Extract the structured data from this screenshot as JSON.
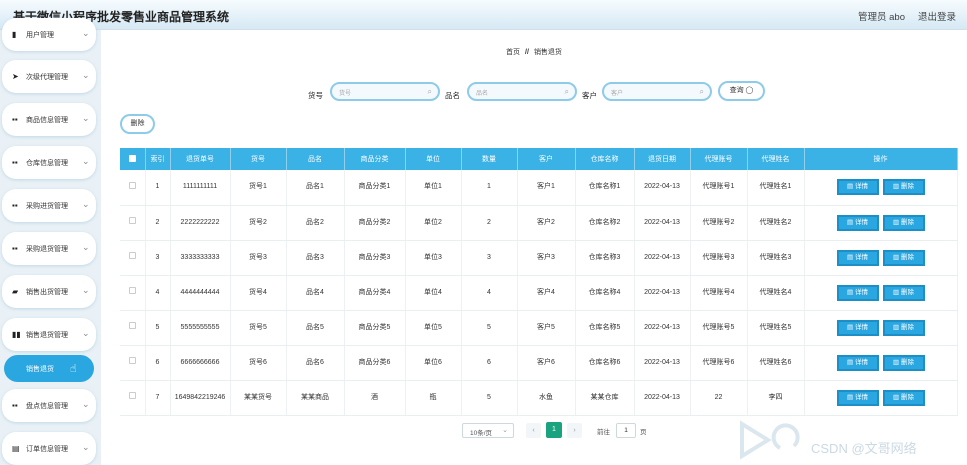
{
  "header": {
    "title": "基于微信小程序批发零售业商品管理系统",
    "admin": "管理员 abo",
    "logout": "退出登录"
  },
  "sidebar": {
    "items": [
      {
        "label": "用户管理",
        "icon": "user-icon",
        "glyph": "▮"
      },
      {
        "label": "次级代理管理",
        "icon": "send-icon",
        "glyph": "➤"
      },
      {
        "label": "商品信息管理",
        "icon": "grid-icon",
        "glyph": "▪▪"
      },
      {
        "label": "仓库信息管理",
        "icon": "grid-icon",
        "glyph": "▪▪"
      },
      {
        "label": "采购进货管理",
        "icon": "grid-icon",
        "glyph": "▪▪"
      },
      {
        "label": "采购退货管理",
        "icon": "grid-icon",
        "glyph": "▪▪"
      },
      {
        "label": "销售出货管理",
        "icon": "briefcase-icon",
        "glyph": "▰"
      },
      {
        "label": "销售退货管理",
        "icon": "chart-icon",
        "glyph": "▮▮"
      },
      {
        "label": "盘点信息管理",
        "icon": "grid-icon",
        "glyph": "▪▪"
      },
      {
        "label": "订单信息管理",
        "icon": "document-icon",
        "glyph": "▤"
      }
    ],
    "active_sub": "销售退货"
  },
  "breadcrumb": {
    "home": "首页",
    "sep": "//",
    "current": "销售退货"
  },
  "search": {
    "fields": [
      {
        "label": "货号",
        "placeholder": "货号"
      },
      {
        "label": "品名",
        "placeholder": "品名"
      },
      {
        "label": "客户",
        "placeholder": "客户"
      }
    ],
    "query_label": "查询 ◯"
  },
  "toolbar": {
    "delete_label": "删除"
  },
  "table": {
    "columns": [
      "",
      "索引",
      "退货单号",
      "货号",
      "品名",
      "商品分类",
      "单位",
      "数量",
      "客户",
      "仓库名称",
      "退货日期",
      "代理账号",
      "代理姓名",
      "操作"
    ],
    "rows": [
      [
        "1",
        "1111111111",
        "货号1",
        "品名1",
        "商品分类1",
        "单位1",
        "1",
        "客户1",
        "仓库名称1",
        "2022-04-13",
        "代理账号1",
        "代理姓名1"
      ],
      [
        "2",
        "2222222222",
        "货号2",
        "品名2",
        "商品分类2",
        "单位2",
        "2",
        "客户2",
        "仓库名称2",
        "2022-04-13",
        "代理账号2",
        "代理姓名2"
      ],
      [
        "3",
        "3333333333",
        "货号3",
        "品名3",
        "商品分类3",
        "单位3",
        "3",
        "客户3",
        "仓库名称3",
        "2022-04-13",
        "代理账号3",
        "代理姓名3"
      ],
      [
        "4",
        "4444444444",
        "货号4",
        "品名4",
        "商品分类4",
        "单位4",
        "4",
        "客户4",
        "仓库名称4",
        "2022-04-13",
        "代理账号4",
        "代理姓名4"
      ],
      [
        "5",
        "5555555555",
        "货号5",
        "品名5",
        "商品分类5",
        "单位5",
        "5",
        "客户5",
        "仓库名称5",
        "2022-04-13",
        "代理账号5",
        "代理姓名5"
      ],
      [
        "6",
        "6666666666",
        "货号6",
        "品名6",
        "商品分类6",
        "单位6",
        "6",
        "客户6",
        "仓库名称6",
        "2022-04-13",
        "代理账号6",
        "代理姓名6"
      ],
      [
        "7",
        "1649842219246",
        "某某货号",
        "某某商品",
        "酒",
        "瓶",
        "5",
        "水鱼",
        "某某仓库",
        "2022-04-13",
        "22",
        "李四"
      ]
    ],
    "detail_label": "▤ 详情",
    "delete_label": "▥ 删除"
  },
  "pagination": {
    "prev": "‹",
    "page_size": "10条/页",
    "current_page": "1",
    "next": "›",
    "goto_label": "前往",
    "goto_value": "1",
    "page_unit": "页"
  },
  "watermark": {
    "text": "CSDN @文哥网络"
  },
  "colors": {
    "accent": "#2aa7e0",
    "header_row": "#3ab2e6",
    "active_page": "#1ba37f"
  }
}
